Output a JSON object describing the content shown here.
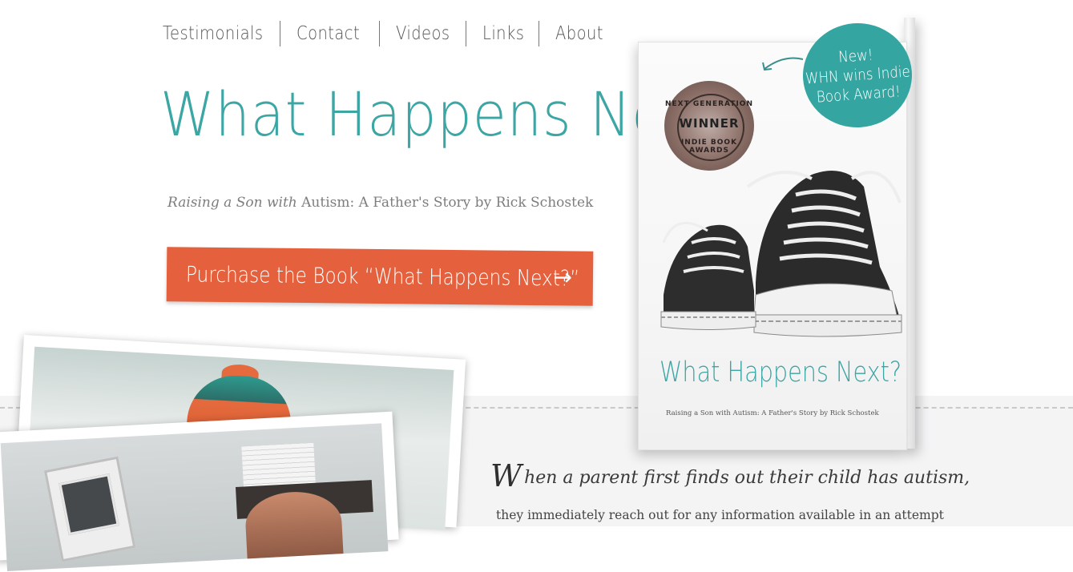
{
  "nav": {
    "items": [
      {
        "label": "Testimonials"
      },
      {
        "label": "Contact"
      },
      {
        "label": "Videos"
      },
      {
        "label": "Links"
      },
      {
        "label": "About"
      }
    ]
  },
  "hero": {
    "title": "What Happens Next?",
    "subtitle_part1": "Raising a",
    "subtitle_part2": "Son",
    "subtitle_part3": "with",
    "subtitle_part4": "Autism: A Father's Story by Rick Schostek",
    "cta_label": "Purchase the Book “What Happens Next?”",
    "cta_arrow": "→"
  },
  "book": {
    "seal_top": "NEXT GENERATION",
    "seal_center": "WINNER",
    "seal_bottom": "INDIE BOOK AWARDS",
    "cover_title": "What Happens Next?",
    "cover_subtitle": "Raising a Son with Autism: A Father's Story  by Rick Schostek"
  },
  "badge": {
    "line1": "New!",
    "line2": "WHN wins Indie",
    "line3": "Book Award!"
  },
  "intro": {
    "drop_cap": "W",
    "lead": "hen a parent first finds out their child has autism,",
    "body": "they immediately reach out for any information available in an attempt"
  },
  "colors": {
    "accent_teal": "#3ba6a4",
    "cta_orange": "#e5603c",
    "badge_teal": "#34a5a1"
  }
}
